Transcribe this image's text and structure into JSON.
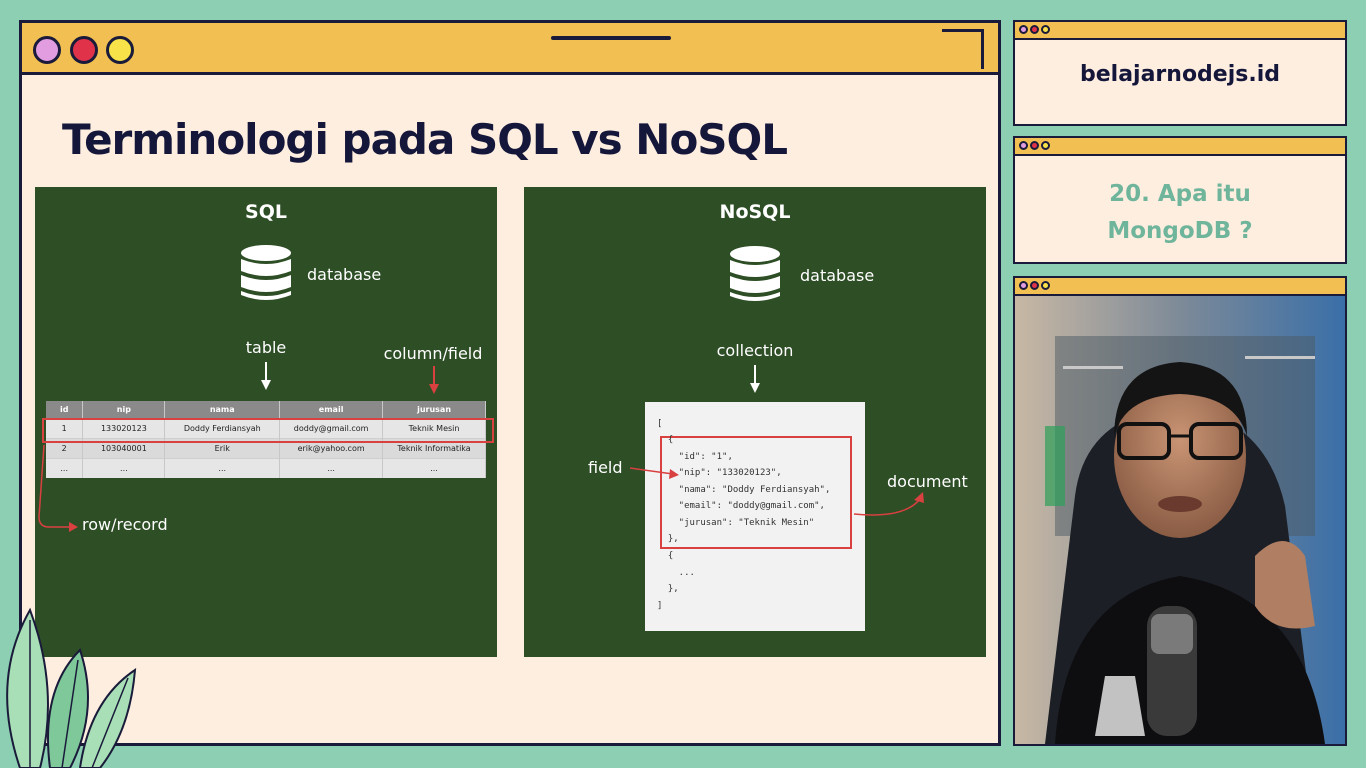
{
  "slide": {
    "title": "Terminologi pada SQL vs NoSQL",
    "sql": {
      "heading": "SQL",
      "db_label": "database",
      "table_label": "table",
      "column_label": "column/field",
      "row_label": "row/record",
      "columns": [
        "id",
        "nip",
        "nama",
        "email",
        "jurusan"
      ],
      "rows": [
        [
          "1",
          "133020123",
          "Doddy Ferdiansyah",
          "doddy@gmail.com",
          "Teknik Mesin"
        ],
        [
          "2",
          "103040001",
          "Erik",
          "erik@yahoo.com",
          "Teknik Informatika"
        ],
        [
          "...",
          "...",
          "...",
          "...",
          "..."
        ]
      ]
    },
    "nosql": {
      "heading": "NoSQL",
      "db_label": "database",
      "collection_label": "collection",
      "field_label": "field",
      "document_label": "document",
      "json_lines": [
        "[",
        "  {",
        "    \"id\": \"1\",",
        "    \"nip\": \"133020123\",",
        "    \"nama\": \"Doddy Ferdiansyah\",",
        "    \"email\": \"doddy@gmail.com\",",
        "    \"jurusan\": \"Teknik Mesin\"",
        "  },",
        "  {",
        "    ...",
        "  },",
        "]"
      ]
    }
  },
  "sidebar": {
    "brand": "belajarnodejs.id",
    "episode_line1": "20. Apa itu",
    "episode_line2": "MongoDB ?"
  },
  "colors": {
    "background": "#8ccfb2",
    "window_bar": "#f2c052",
    "slide_bg": "#fdeee0",
    "panel_green": "#2e4e26",
    "highlight_red": "#d94040",
    "navy": "#14163a",
    "teal_text": "#6fb59b"
  },
  "icons": [
    "database-icon",
    "down-arrow-icon",
    "red-arrow-icon",
    "leaf-icon",
    "window-dot-icon"
  ]
}
